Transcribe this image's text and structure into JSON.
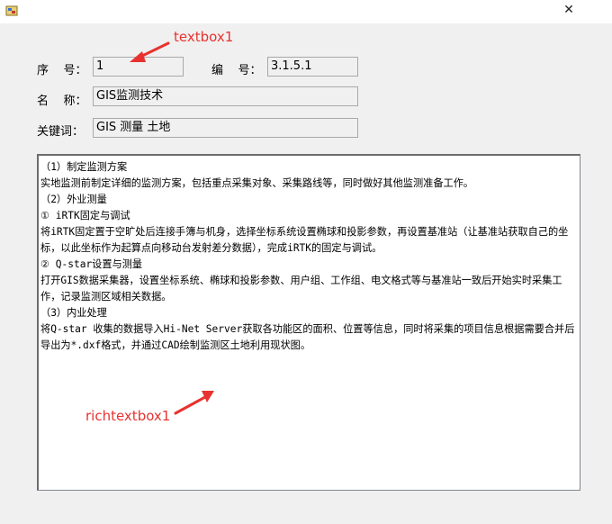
{
  "window": {
    "close_glyph": "✕"
  },
  "form": {
    "seq_label": "序    号：",
    "seq_value": "1",
    "code_label": "编    号：",
    "code_value": "3.1.5.1",
    "name_label": "名    称：",
    "name_value": "GIS监测技术",
    "keyword_label": "关键词：",
    "keyword_value": "GIS 测量 土地"
  },
  "richtext": {
    "content": "（1）制定监测方案\n实地监测前制定详细的监测方案，包括重点采集对象、采集路线等，同时做好其他监测准备工作。\n（2）外业测量\n① iRTK固定与调试\n将iRTK固定置于空旷处后连接手簿与机身，选择坐标系统设置椭球和投影参数，再设置基准站（让基准站获取自己的坐标，以此坐标作为起算点向移动台发射差分数据），完成iRTK的固定与调试。\n② Q-star设置与测量\n打开GIS数据采集器，设置坐标系统、椭球和投影参数、用户组、工作组、电文格式等与基准站一致后开始实时采集工作，记录监测区域相关数据。\n（3）内业处理\n将Q-star 收集的数据导入Hi-Net Server获取各功能区的面积、位置等信息，同时将采集的项目信息根据需要合并后导出为*.dxf格式，并通过CAD绘制监测区土地利用现状图。"
  },
  "annotations": {
    "textbox_label": "textbox1",
    "richtextbox_label": "richtextbox1",
    "color": "#e8322f"
  }
}
